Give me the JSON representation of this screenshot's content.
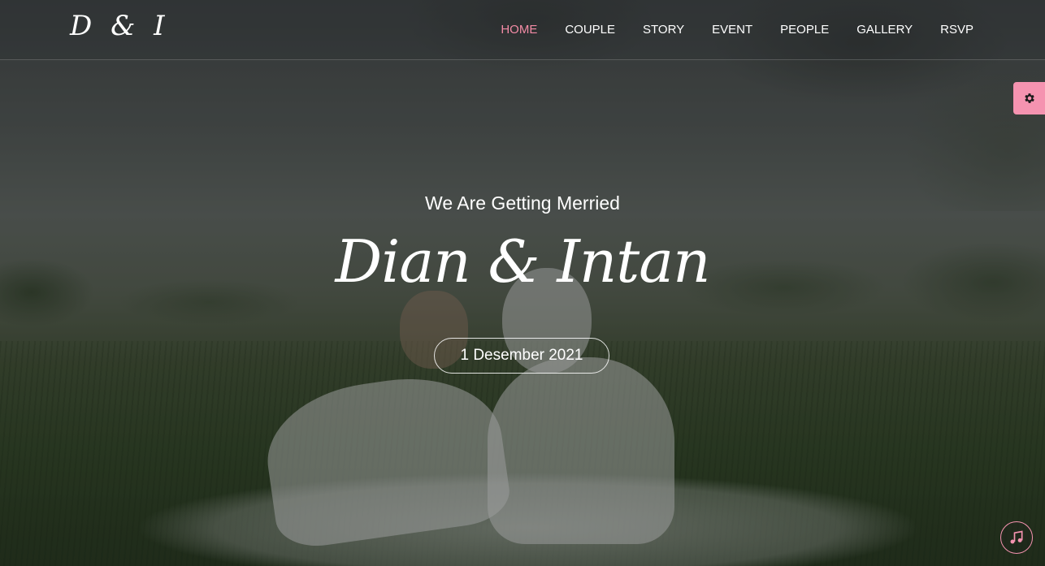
{
  "brand": {
    "logo": "D & I"
  },
  "nav": {
    "items": [
      {
        "label": "HOME",
        "active": true
      },
      {
        "label": "COUPLE",
        "active": false
      },
      {
        "label": "STORY",
        "active": false
      },
      {
        "label": "EVENT",
        "active": false
      },
      {
        "label": "PEOPLE",
        "active": false
      },
      {
        "label": "GALLERY",
        "active": false
      },
      {
        "label": "RSVP",
        "active": false
      }
    ]
  },
  "hero": {
    "tagline": "We Are Getting Merried",
    "names": "Dian & Intan",
    "date": "1 Desember 2021"
  },
  "controls": {
    "settings_icon": "gear-icon",
    "music_icon": "music-note-icon"
  },
  "colors": {
    "accent": "#f593b0",
    "nav_active": "#f28ba5",
    "text": "#ffffff"
  }
}
